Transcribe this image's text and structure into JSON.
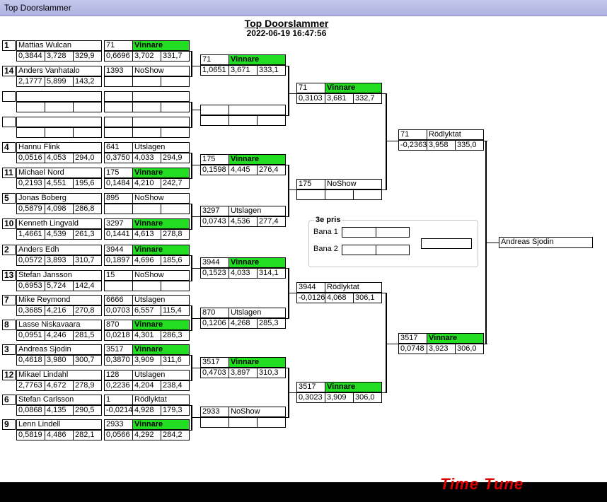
{
  "window": {
    "title": "Top Doorslammer"
  },
  "header": {
    "title": "Top Doorslammer",
    "datetime": "2022-06-19 16:47:56"
  },
  "pris3": {
    "title": "3e pris",
    "bana1": "Bana 1",
    "bana2": "Bana 2"
  },
  "winner": "Andreas Sjodin",
  "logo": "Time Tune",
  "r1": [
    {
      "seed": "1",
      "name": "Mattias Wulcan",
      "rt": "0,3844",
      "et": "3,728",
      "sp": "329,9",
      "no": "71",
      "status": "Vinnare",
      "rt2": "0,6696",
      "et2": "3,702",
      "sp2": "331,7",
      "green": true
    },
    {
      "seed": "14",
      "name": "Anders Vanhatalo",
      "rt": "2,1777",
      "et": "5,899",
      "sp": "143,2",
      "no": "1393",
      "status": "NoShow",
      "rt2": "",
      "et2": "",
      "sp2": "",
      "green": false
    },
    {
      "seed": "",
      "name": "",
      "rt": "",
      "et": "",
      "sp": "",
      "no": "",
      "status": "",
      "rt2": "",
      "et2": "",
      "sp2": "",
      "green": false
    },
    {
      "seed": "",
      "name": "",
      "rt": "",
      "et": "",
      "sp": "",
      "no": "",
      "status": "",
      "rt2": "",
      "et2": "",
      "sp2": "",
      "green": false
    },
    {
      "seed": "4",
      "name": "Hannu Flink",
      "rt": "0,0516",
      "et": "4,053",
      "sp": "294,0",
      "no": "641",
      "status": "Utslagen",
      "rt2": "0,3750",
      "et2": "4,033",
      "sp2": "294,9",
      "green": false
    },
    {
      "seed": "11",
      "name": "Michael Nord",
      "rt": "0,2193",
      "et": "4,551",
      "sp": "195,6",
      "no": "175",
      "status": "Vinnare",
      "rt2": "0,1484",
      "et2": "4,210",
      "sp2": "242,7",
      "green": true
    },
    {
      "seed": "5",
      "name": "Jonas Boberg",
      "rt": "0,5879",
      "et": "4,098",
      "sp": "286,8",
      "no": "895",
      "status": "NoShow",
      "rt2": "",
      "et2": "",
      "sp2": "",
      "green": false
    },
    {
      "seed": "10",
      "name": "Kenneth Lingvald",
      "rt": "1,4661",
      "et": "4,539",
      "sp": "261,3",
      "no": "3297",
      "status": "Vinnare",
      "rt2": "0,1441",
      "et2": "4,613",
      "sp2": "278,8",
      "green": true
    },
    {
      "seed": "2",
      "name": "Anders Edh",
      "rt": "0,0572",
      "et": "3,893",
      "sp": "310,7",
      "no": "3944",
      "status": "Vinnare",
      "rt2": "0,1897",
      "et2": "4,696",
      "sp2": "185,6",
      "green": true
    },
    {
      "seed": "13",
      "name": "Stefan Jansson",
      "rt": "0,6953",
      "et": "5,724",
      "sp": "142,4",
      "no": "15",
      "status": "NoShow",
      "rt2": "",
      "et2": "",
      "sp2": "",
      "green": false
    },
    {
      "seed": "7",
      "name": "Mike Reymond",
      "rt": "0,3685",
      "et": "4,216",
      "sp": "270,8",
      "no": "6666",
      "status": "Utslagen",
      "rt2": "0,0703",
      "et2": "6,557",
      "sp2": "115,4",
      "green": false
    },
    {
      "seed": "8",
      "name": "Lasse Niskavaara",
      "rt": "0,0951",
      "et": "4,246",
      "sp": "281,5",
      "no": "870",
      "status": "Vinnare",
      "rt2": "0,0218",
      "et2": "4,301",
      "sp2": "286,3",
      "green": true
    },
    {
      "seed": "3",
      "name": "Andreas Sjodin",
      "rt": "0,4618",
      "et": "3,980",
      "sp": "300,7",
      "no": "3517",
      "status": "Vinnare",
      "rt2": "0,3870",
      "et2": "3,909",
      "sp2": "311,6",
      "green": true
    },
    {
      "seed": "12",
      "name": "Mikael Lindahl",
      "rt": "2,7763",
      "et": "4,672",
      "sp": "278,9",
      "no": "128",
      "status": "Utslagen",
      "rt2": "0,2236",
      "et2": "4,204",
      "sp2": "238,4",
      "green": false
    },
    {
      "seed": "6",
      "name": "Stefan Carlsson",
      "rt": "0,0868",
      "et": "4,135",
      "sp": "290,5",
      "no": "1",
      "status": "Rödlyktat",
      "rt2": "-0,0214",
      "et2": "4,928",
      "sp2": "179,3",
      "green": false
    },
    {
      "seed": "9",
      "name": "Lenn Lindell",
      "rt": "0,5819",
      "et": "4,486",
      "sp": "282,1",
      "no": "2933",
      "status": "Vinnare",
      "rt2": "0,0566",
      "et2": "4,292",
      "sp2": "284,2",
      "green": true
    }
  ],
  "r2": [
    {
      "no": "71",
      "status": "Vinnare",
      "rt": "1,0651",
      "et": "3,671",
      "sp": "333,1",
      "green": true
    },
    {
      "no": "",
      "status": "",
      "rt": "",
      "et": "",
      "sp": "",
      "green": false
    },
    {
      "no": "175",
      "status": "Vinnare",
      "rt": "0,1598",
      "et": "4,445",
      "sp": "276,4",
      "green": true
    },
    {
      "no": "3297",
      "status": "Utslagen",
      "rt": "0,0743",
      "et": "4,536",
      "sp": "277,4",
      "green": false
    },
    {
      "no": "3944",
      "status": "Vinnare",
      "rt": "0,1523",
      "et": "4,033",
      "sp": "314,1",
      "green": true
    },
    {
      "no": "870",
      "status": "Utslagen",
      "rt": "0,1206",
      "et": "4,268",
      "sp": "285,3",
      "green": false
    },
    {
      "no": "3517",
      "status": "Vinnare",
      "rt": "0,4703",
      "et": "3,897",
      "sp": "310,3",
      "green": true
    },
    {
      "no": "2933",
      "status": "NoShow",
      "rt": "",
      "et": "",
      "sp": "",
      "green": false
    }
  ],
  "r3": [
    {
      "no": "71",
      "status": "Vinnare",
      "rt": "0,3103",
      "et": "3,681",
      "sp": "332,7",
      "green": true
    },
    {
      "no": "175",
      "status": "NoShow",
      "rt": "",
      "et": "",
      "sp": "",
      "green": false
    },
    {
      "no": "3944",
      "status": "Rödlyktat",
      "rt": "-0,0126",
      "et": "4,068",
      "sp": "306,1",
      "green": false
    },
    {
      "no": "3517",
      "status": "Vinnare",
      "rt": "0,3023",
      "et": "3,909",
      "sp": "306,0",
      "green": true
    }
  ],
  "r4": [
    {
      "no": "71",
      "status": "Rödlyktat",
      "rt": "-0,2363",
      "et": "3,958",
      "sp": "335,0",
      "green": false
    },
    {
      "no": "3517",
      "status": "Vinnare",
      "rt": "0,0748",
      "et": "3,923",
      "sp": "306,0",
      "green": true
    }
  ]
}
